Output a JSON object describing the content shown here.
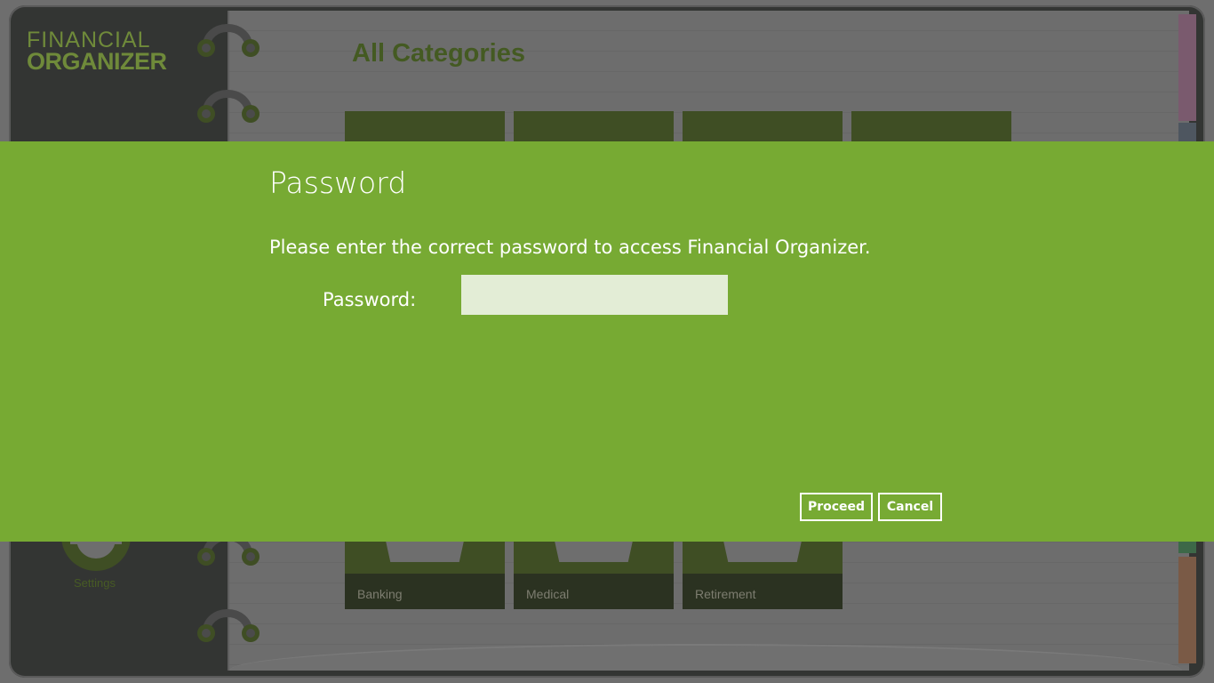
{
  "app": {
    "logo_line1": "FINANCIAL",
    "logo_line2": "ORGANIZER"
  },
  "page": {
    "title": "All Categories"
  },
  "categories": [
    {
      "label": "Banking"
    },
    {
      "label": "Medical"
    },
    {
      "label": "Retirement"
    }
  ],
  "sidebar": {
    "settings_label": "Settings",
    "settings_icon": "gear-icon"
  },
  "dialog": {
    "title": "Password",
    "message": "Please enter the correct password to access Financial Organizer.",
    "password_label": "Password:",
    "password_value": "",
    "proceed_label": "Proceed",
    "cancel_label": "Cancel"
  },
  "colors": {
    "dialog_background": "#77aa33",
    "accent_dark": "#3f4e24",
    "overlay_grey": "#6e6e6e"
  }
}
